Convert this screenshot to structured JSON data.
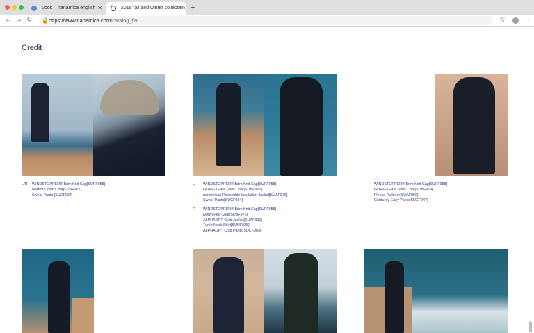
{
  "browser": {
    "tabs": [
      {
        "title": "Look – nanamica english",
        "active": false
      },
      {
        "title": "2019 fall and winter collection",
        "active": true
      }
    ],
    "url_host": "https://www.nanamica.com",
    "url_path": "/catalog_fw/"
  },
  "page": {
    "heading": "Credit",
    "colors": {
      "heading": "#1f2f5c",
      "link": "#2e3d82"
    },
    "row1": [
      {
        "label": "L/R",
        "items": [
          "WINDSTOPPER® Brim Knit Cap[SUPF958]",
          "Harbor Down Coat[SUBF967]",
          "Sweat Pants [SUCF934]"
        ]
      },
      {
        "groups": [
          {
            "label": "L",
            "items": [
              "WINDSTOPPER® Brim Knit Cap[SUPF958]",
              "GORE-TEX® Shell Coat[SUBF921]",
              "nanamican Reversible Insulation Jacket[SUAF979]",
              "Sweat Pants[SUCF934]"
            ]
          },
          {
            "label": "R",
            "items": [
              "WINDSTOPPER® Brim Knit Cap[SUPF958]",
              "Down Pea Coat[SUBF976]",
              "ALPHADRY Club Jacket[SUAF901]",
              "Turtle Neck Shirt[SUHF935]",
              "ALPHADRY Club Pants[SUCF903]"
            ]
          }
        ]
      },
      {
        "items": [
          "WINDSTOPPER® Brim Knit Cap[SUPF958]",
          "GORE-TEX® Shell Coat[SUBF919]",
          "Fleece Pullover[SUAF956]",
          "Corduroy Easy Pants[SUCF947]"
        ]
      }
    ]
  }
}
